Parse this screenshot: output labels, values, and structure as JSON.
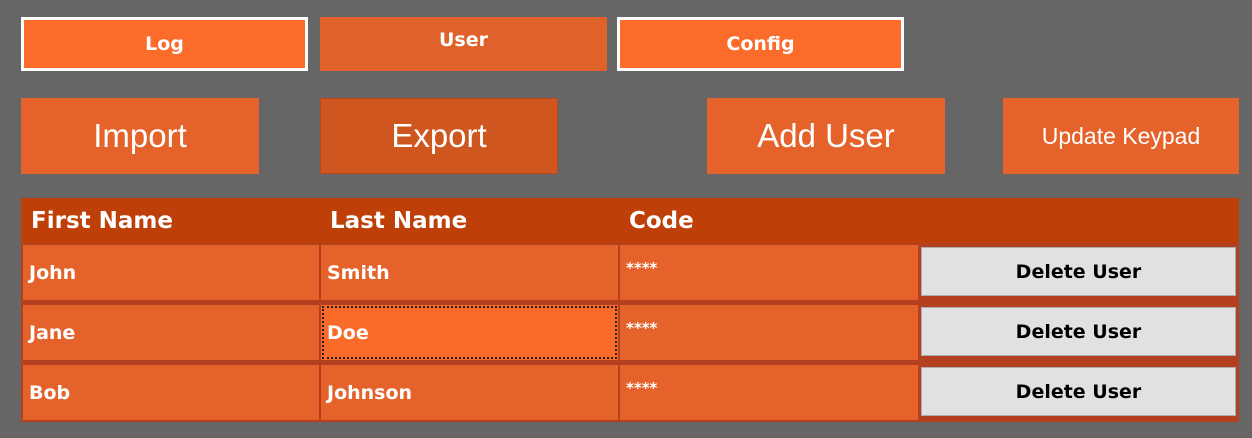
{
  "tabs": {
    "log": "Log",
    "user": "User",
    "config": "Config"
  },
  "actions": {
    "import": "Import",
    "export": "Export",
    "add_user": "Add User",
    "update_keypad": "Update Keypad"
  },
  "table": {
    "columns": [
      "First Name",
      "Last Name",
      "Code"
    ],
    "rows": [
      {
        "first": "John",
        "last": "Smith",
        "code": "****",
        "action": "Delete User"
      },
      {
        "first": "Jane",
        "last": "Doe",
        "code": "****",
        "action": "Delete User"
      },
      {
        "first": "Bob",
        "last": "Johnson",
        "code": "****",
        "action": "Delete User"
      }
    ]
  },
  "colors": {
    "background": "#666666",
    "accent": "#e5622a",
    "accent_bright": "#fb6c2a",
    "header": "#bf3f08",
    "button_gray": "#e1e1e1"
  }
}
